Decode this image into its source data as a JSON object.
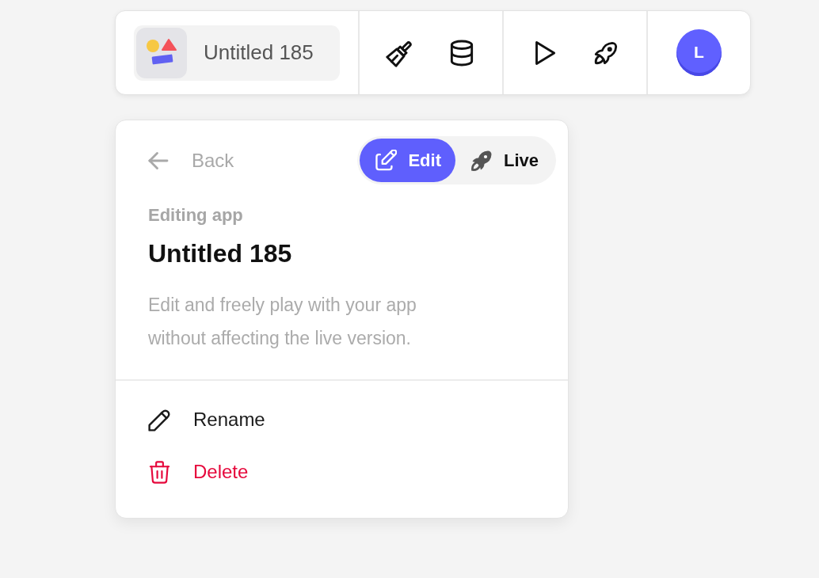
{
  "toolbar": {
    "app_name": "Untitled 185",
    "avatar": {
      "initial": "L"
    }
  },
  "panel": {
    "back": "Back",
    "mode_toggle": [
      {
        "label": "Edit",
        "kind": "edit",
        "selected": true
      },
      {
        "label": "Live",
        "kind": "live",
        "selected": false
      }
    ],
    "eyebrow": "Editing app",
    "title": "Untitled 185",
    "description": "Edit and freely play with your app without affecting the live version.",
    "menu": [
      {
        "label": "Rename",
        "kind": "rename"
      },
      {
        "label": "Delete",
        "kind": "delete"
      }
    ]
  }
}
